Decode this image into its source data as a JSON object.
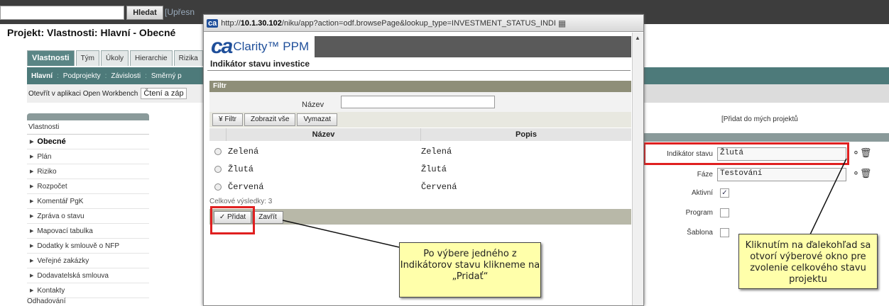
{
  "app": {
    "search_button": "Hledat",
    "search_link": "[Upřesn",
    "project_title": "Projekt: Vlastnosti: Hlavní - Obecné"
  },
  "tabs": [
    "Vlastnosti",
    "Tým",
    "Úkoly",
    "Hierarchie",
    "Rizika"
  ],
  "subnav": [
    "Hlavní",
    "Podprojekty",
    "Závislosti",
    "Směrný p"
  ],
  "openbar": {
    "label": "Otevřít v aplikaci Open Workbench",
    "field": "Čtení a záp"
  },
  "sidebar": {
    "title": "Vlastnosti",
    "items": [
      "Obecné",
      "Plán",
      "Riziko",
      "Rozpočet",
      "Komentář PgK",
      "Zpráva o stavu",
      "Mapovací tabulka",
      "Dodatky k smlouvě o NFP",
      "Veřejné zakázky",
      "Dodavatelská smlouva",
      "Kontakty"
    ],
    "footer": "Odhadování"
  },
  "right": {
    "add_link": "[Přidat do mých projektů",
    "fields": [
      {
        "label": "Indikátor stavu",
        "value": "Žlutá"
      },
      {
        "label": "Fáze",
        "value": "Testování"
      }
    ],
    "checks": [
      {
        "label": "Aktivní",
        "checked": "✓"
      },
      {
        "label": "Program",
        "checked": ""
      },
      {
        "label": "Šablona",
        "checked": ""
      }
    ]
  },
  "popup": {
    "url_host": "http://",
    "url_bold": "10.1.30.102",
    "url_rest": "/niku/app?action=odf.browsePage&lookup_type=INVESTMENT_STATUS_INDI",
    "ca_badge": "ca",
    "logo_ca": "ca",
    "logo_product": "Clarity™ PPM",
    "title": "Indikátor stavu investice",
    "filter_header": "Filtr",
    "filter_label": "Název",
    "filter_buttons": [
      "¥ Filtr",
      "Zobrazit vše",
      "Vymazat"
    ],
    "columns": [
      "Název",
      "Popis"
    ],
    "rows": [
      {
        "name": "Zelená",
        "desc": "Zelená"
      },
      {
        "name": "Žlutá",
        "desc": "Žlutá"
      },
      {
        "name": "Červená",
        "desc": "Červená"
      }
    ],
    "total": "Celkové výsledky: 3",
    "add_button": "✓ Přidat",
    "close_button": "Zavřít"
  },
  "notes": {
    "left": "Po výbere jedného z Indikátorov stavu klikneme na „Pridať“",
    "right": "Kliknutím na ďalekohľad sa otvorí výberové okno pre zvolenie celkového stavu projektu"
  },
  "colors": {
    "accent": "#4d7a7a",
    "highlight": "#e02020",
    "note": "#ffffaa"
  }
}
